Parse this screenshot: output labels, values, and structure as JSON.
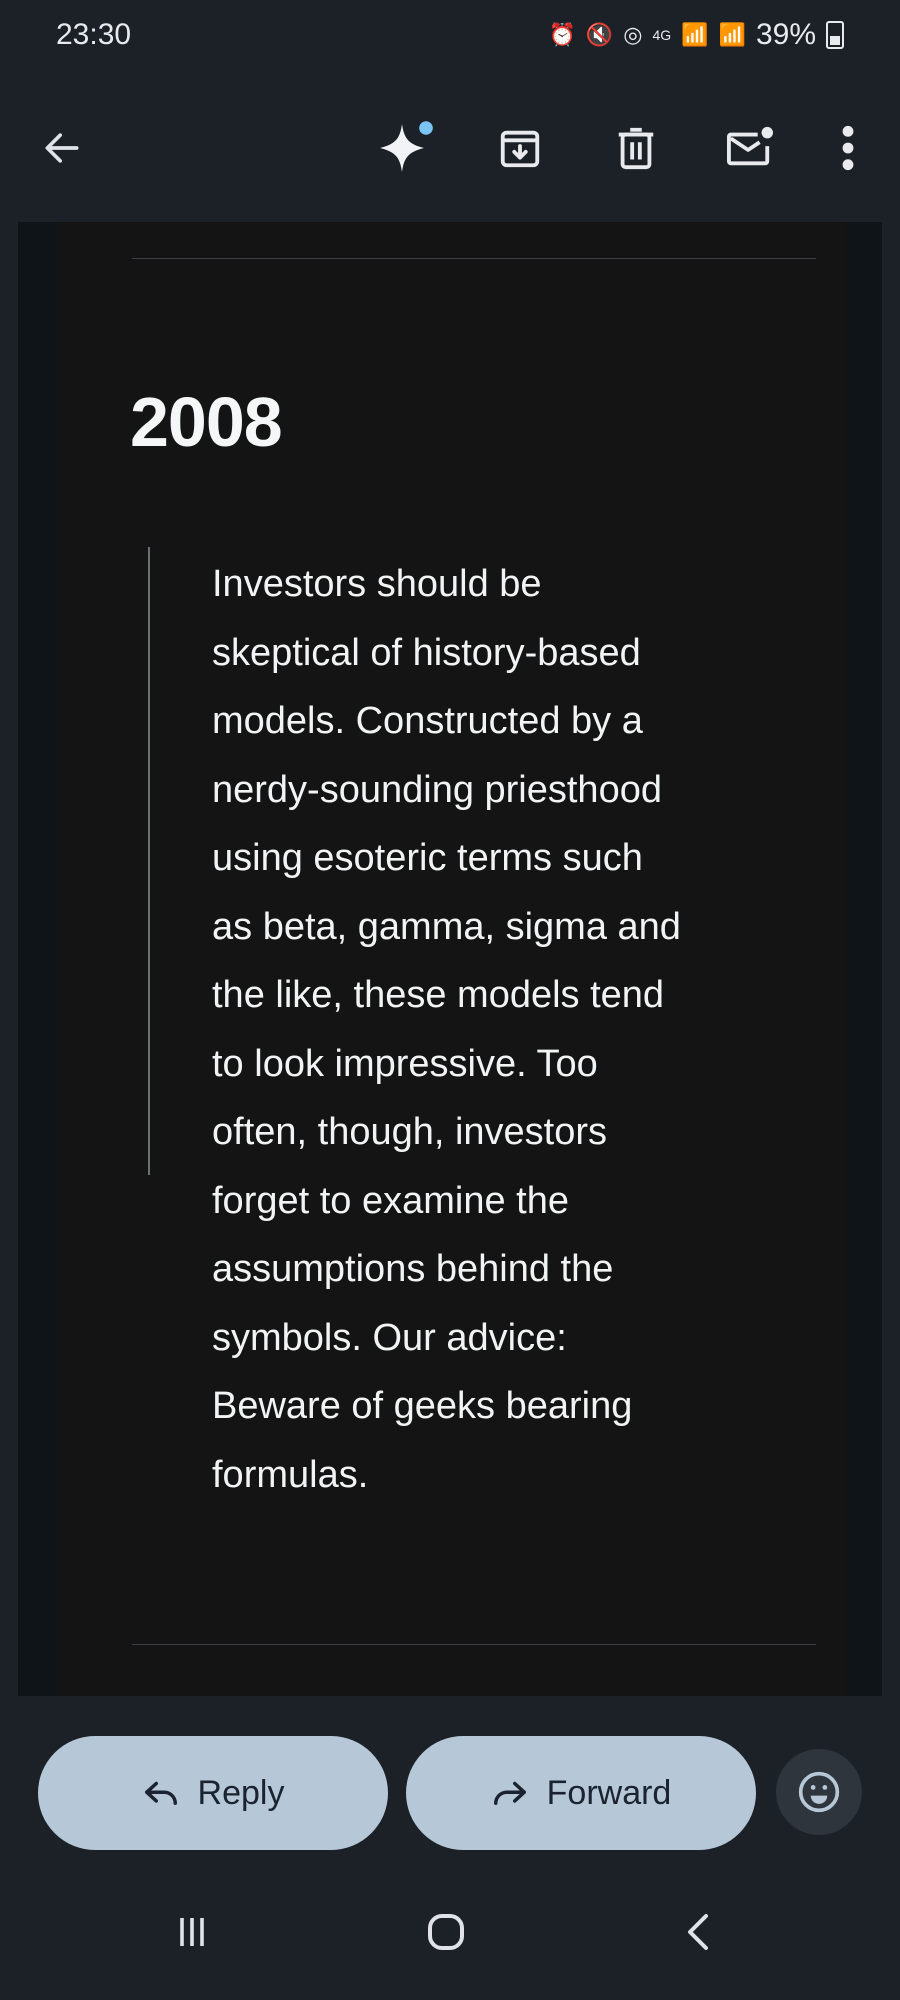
{
  "status_bar": {
    "time": "23:30",
    "network": "4G",
    "battery": "39%"
  },
  "toolbar": {
    "icons": [
      "back-arrow-icon",
      "gemini-sparkle-icon",
      "archive-icon",
      "delete-icon",
      "mark-unread-icon",
      "more-vert-icon"
    ]
  },
  "email": {
    "heading": "2008",
    "quote_lines": [
      "Investors should be",
      "skeptical of history-based",
      "models. Constructed by a",
      "nerdy-sounding priesthood",
      "using esoteric terms such",
      "as beta, gamma, sigma and",
      "the like, these models tend",
      "to look impressive. Too",
      "often, though, investors",
      "forget to examine the",
      "assumptions behind the",
      "symbols. Our advice:",
      "Beware of geeks bearing",
      "formulas."
    ]
  },
  "actions": {
    "reply_label": "Reply",
    "forward_label": "Forward"
  },
  "colors": {
    "background": "#1c2128",
    "card": "#141414",
    "pill": "#b6c8d7",
    "accent_dot": "#7cc4f4"
  }
}
